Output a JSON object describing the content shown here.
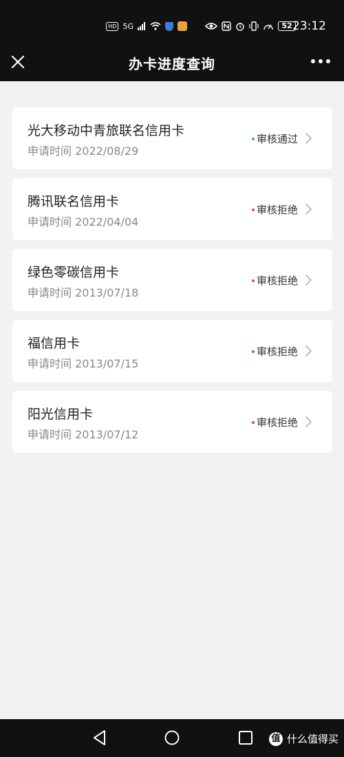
{
  "status_bar": {
    "hd": "HD",
    "network": "5G",
    "battery": "52",
    "time": "23:12"
  },
  "header": {
    "title": "办卡进度查询",
    "close_icon": "close-icon",
    "more_icon": "more-icon"
  },
  "cards": [
    {
      "name": "光大移动中青旅联名信用卡",
      "date": "申请时间 2022/08/29",
      "status": "审核通过",
      "status_color": "#3cb371"
    },
    {
      "name": "腾讯联名信用卡",
      "date": "申请时间 2022/04/04",
      "status": "审核拒绝",
      "status_color": "#e8483c"
    },
    {
      "name": "绿色零碳信用卡",
      "date": "申请时间 2013/07/18",
      "status": "审核拒绝",
      "status_color": "#e8483c"
    },
    {
      "name": "福信用卡",
      "date": "申请时间 2013/07/15",
      "status": "审核拒绝",
      "status_color": "#e8483c"
    },
    {
      "name": "阳光信用卡",
      "date": "申请时间 2013/07/12",
      "status": "审核拒绝",
      "status_color": "#e8483c"
    }
  ],
  "watermark": {
    "logo": "值",
    "text": "什么值得买"
  }
}
